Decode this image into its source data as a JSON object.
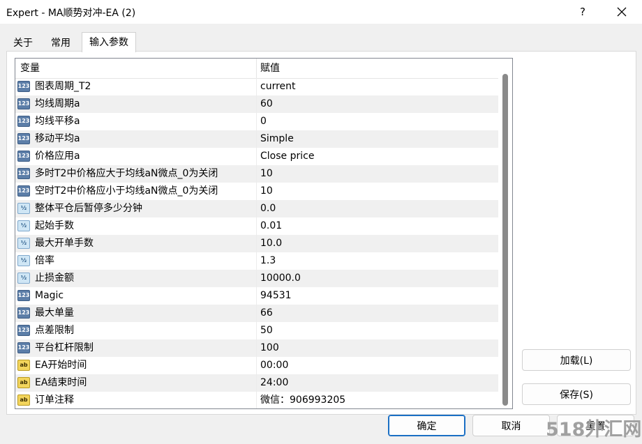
{
  "window": {
    "title": "Expert - MA顺势对冲-EA (2)",
    "help_label": "?",
    "close_icon": "close-icon"
  },
  "tabs": [
    {
      "label": "关于",
      "active": false
    },
    {
      "label": "常用",
      "active": false
    },
    {
      "label": "输入参数",
      "active": true
    }
  ],
  "grid": {
    "columns": {
      "variable": "变量",
      "value": "赋值"
    },
    "rows": [
      {
        "type": "int",
        "icon_text": "123",
        "name": "图表周期_T2",
        "value": "current"
      },
      {
        "type": "int",
        "icon_text": "123",
        "name": "均线周期a",
        "value": "60"
      },
      {
        "type": "int",
        "icon_text": "123",
        "name": "均线平移a",
        "value": "0"
      },
      {
        "type": "int",
        "icon_text": "123",
        "name": "移动平均a",
        "value": "Simple"
      },
      {
        "type": "int",
        "icon_text": "123",
        "name": "价格应用a",
        "value": "Close price"
      },
      {
        "type": "int",
        "icon_text": "123",
        "name": "多时T2中价格应大于均线aN微点_0为关闭",
        "value": "10"
      },
      {
        "type": "int",
        "icon_text": "123",
        "name": "空时T2中价格应小于均线aN微点_0为关闭",
        "value": "10"
      },
      {
        "type": "dbl",
        "icon_text": "½",
        "name": "整体平仓后暂停多少分钟",
        "value": "0.0"
      },
      {
        "type": "dbl",
        "icon_text": "½",
        "name": "起始手数",
        "value": "0.01"
      },
      {
        "type": "dbl",
        "icon_text": "½",
        "name": "最大开单手数",
        "value": "10.0"
      },
      {
        "type": "dbl",
        "icon_text": "½",
        "name": "倍率",
        "value": "1.3"
      },
      {
        "type": "dbl",
        "icon_text": "½",
        "name": "止损金额",
        "value": "10000.0"
      },
      {
        "type": "int",
        "icon_text": "123",
        "name": "Magic",
        "value": "94531"
      },
      {
        "type": "int",
        "icon_text": "123",
        "name": "最大单量",
        "value": "66"
      },
      {
        "type": "int",
        "icon_text": "123",
        "name": "点差限制",
        "value": "50"
      },
      {
        "type": "int",
        "icon_text": "123",
        "name": "平台杠杆限制",
        "value": "100"
      },
      {
        "type": "str",
        "icon_text": "ab",
        "name": "EA开始时间",
        "value": "00:00"
      },
      {
        "type": "str",
        "icon_text": "ab",
        "name": "EA结束时间",
        "value": "24:00"
      },
      {
        "type": "str",
        "icon_text": "ab",
        "name": "订单注释",
        "value": "微信：906993205"
      }
    ]
  },
  "buttons": {
    "load": "加载(L)",
    "save": "保存(S)",
    "ok": "确定",
    "cancel": "取消",
    "reset": "重置"
  },
  "watermark": "518外汇网",
  "colors": {
    "accent": "#1a6fc4",
    "int_icon": "#5c7ea8",
    "double_icon": "#cfe6f5",
    "string_icon": "#f2d45c"
  }
}
